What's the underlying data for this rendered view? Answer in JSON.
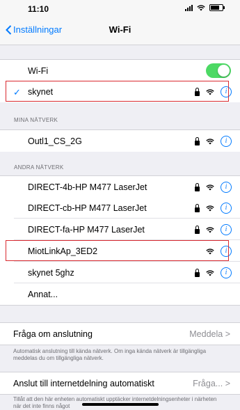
{
  "status": {
    "time": "11:10"
  },
  "nav": {
    "back_label": "Inställningar",
    "title": "Wi-Fi"
  },
  "wifi_toggle": {
    "label": "Wi-Fi",
    "on": true
  },
  "connected": {
    "name": "skynet"
  },
  "my_networks": {
    "header": "MINA NÄTVERK",
    "items": [
      {
        "name": "Outl1_CS_2G",
        "secured": true
      }
    ]
  },
  "other_networks": {
    "header": "ANDRA NÄTVERK",
    "items": [
      {
        "name": "DIRECT-4b-HP M477 LaserJet",
        "secured": true
      },
      {
        "name": "DIRECT-cb-HP M477 LaserJet",
        "secured": true
      },
      {
        "name": "DIRECT-fa-HP M477 LaserJet",
        "secured": true
      },
      {
        "name": "MiotLinkAp_3ED2",
        "secured": false
      },
      {
        "name": "skynet 5ghz",
        "secured": true
      }
    ],
    "other_label": "Annat..."
  },
  "ask_join": {
    "label": "Fråga om anslutning",
    "value": "Meddela",
    "footnote": "Automatisk anslutning till kända nätverk. Om inga kända nätverk är tillgängliga meddelas du om tillgängliga nätverk."
  },
  "hotspot": {
    "label": "Anslut till internetdelning automatiskt",
    "value": "Fråga...",
    "footnote": "Tillåt att den här enheten automatiskt upptäcker internetdelningsenheter i närheten när det inte finns något"
  },
  "colors": {
    "accent": "#007aff",
    "toggle_on": "#4cd964",
    "highlight": "#d9292f"
  }
}
